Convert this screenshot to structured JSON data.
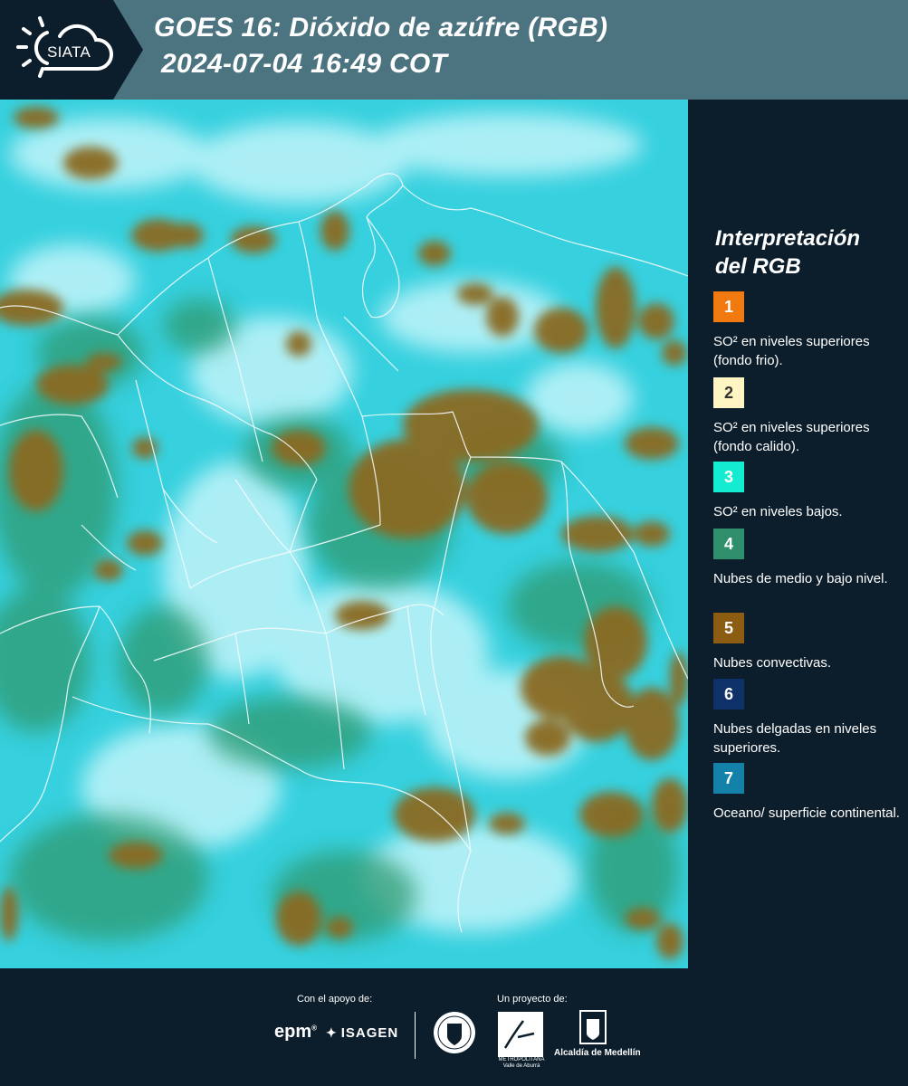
{
  "header": {
    "logo_text": "SIATA",
    "title_line_1": "GOES 16: Dióxido de azúfre (RGB)",
    "title_line_2": "2024-07-04 16:49 COT"
  },
  "map": {
    "background_color": "#36d0de",
    "cloud_colors": [
      "#8a6a22",
      "#2e9a70",
      "#b8f2f8"
    ]
  },
  "legend": {
    "title_line_1": "Interpretación",
    "title_line_2": "del RGB",
    "items": [
      {
        "number": "1",
        "color": "#f07a10",
        "label": "SO² en niveles superiores (fondo frio)."
      },
      {
        "number": "2",
        "color": "#fff5c2",
        "label": "SO² en niveles superiores (fondo calido)."
      },
      {
        "number": "3",
        "color": "#14ecd2",
        "label": "SO² en niveles bajos."
      },
      {
        "number": "4",
        "color": "#2f8f6c",
        "label": "Nubes de medio y bajo nivel."
      },
      {
        "number": "5",
        "color": "#8b5c12",
        "label": "Nubes convectivas."
      },
      {
        "number": "6",
        "color": "#0d3168",
        "label": "Nubes delgadas en niveles superiores."
      },
      {
        "number": "7",
        "color": "#1481a8",
        "label": "Oceano/ superficie continental."
      }
    ]
  },
  "footer": {
    "support_label": "Con el apoyo de:",
    "project_label": "Un proyecto de:",
    "epm": "epm",
    "isagen": "ISAGEN",
    "area_label": "METROPOLITANA Valle de Aburrá",
    "alcaldia": "Alcaldía de Medellín"
  }
}
